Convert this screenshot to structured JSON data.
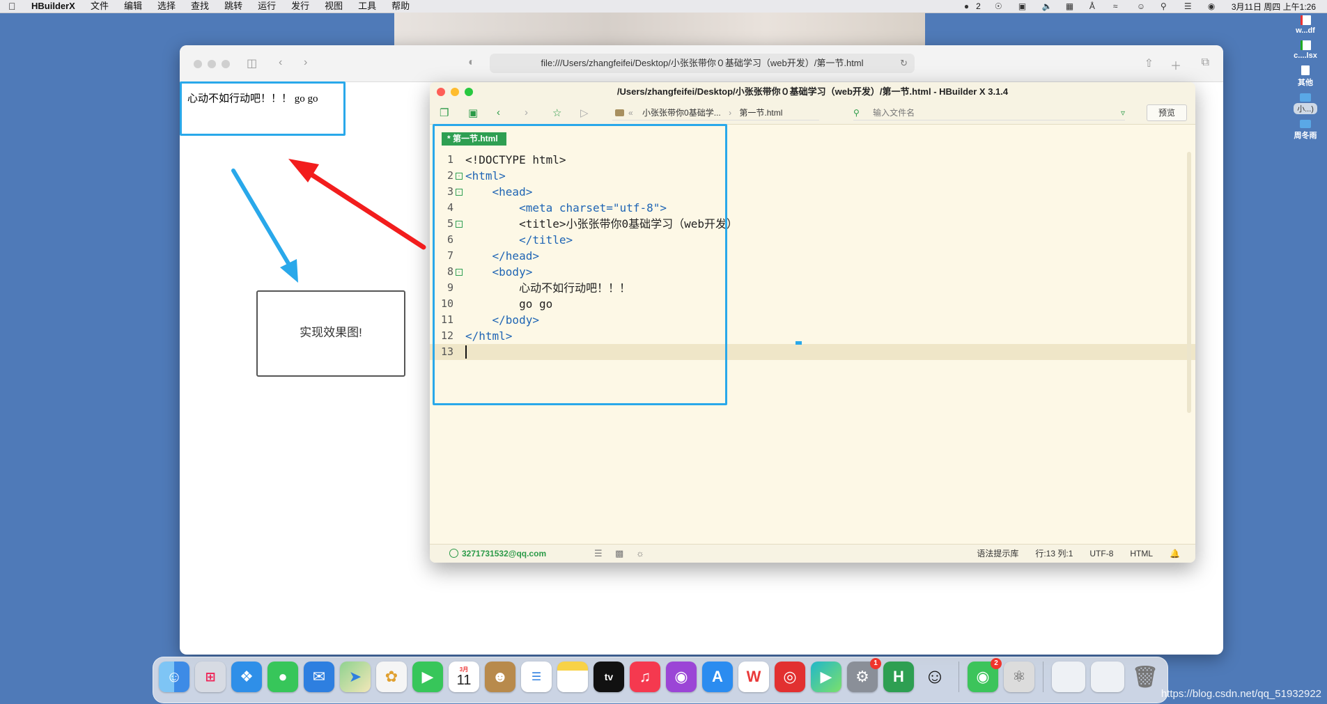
{
  "menubar": {
    "apple": "",
    "app_name": "HBuilderX",
    "menus": [
      "文件",
      "编辑",
      "选择",
      "查找",
      "跳转",
      "运行",
      "发行",
      "视图",
      "工具",
      "帮助"
    ],
    "wechat_count": "2",
    "datetime": "3月11日 周四 上午1:26"
  },
  "desktop_files": [
    {
      "label": "w...df",
      "kind": "pdf"
    },
    {
      "label": "c....lsx",
      "kind": "xlsx"
    },
    {
      "label": "其他",
      "kind": "doc"
    },
    {
      "label": "小...)",
      "kind": "folder"
    },
    {
      "label": "周冬雨",
      "kind": "folder"
    }
  ],
  "browser": {
    "url": "file:///Users/zhangfeifei/Desktop/小张张带你０基础学习（web开发）/第一节.html",
    "page_text": "心动不如行动吧！！！ go go"
  },
  "annotation": {
    "effect_label": "实现效果图!"
  },
  "editor": {
    "title": "/Users/zhangfeifei/Desktop/小张张带你０基础学习（web开发）/第一节.html - HBuilder X 3.1.4",
    "breadcrumb_parent": "小张张带你0基础学...",
    "breadcrumb_file": "第一节.html",
    "search_placeholder": "输入文件名",
    "preview_label": "预览",
    "tab_label": "* 第一节.html",
    "code_lines": [
      "<!DOCTYPE html>",
      "<html>",
      "    <head>",
      "        <meta charset=\"utf-8\">",
      "        <title>小张张带你0基础学习（web开发）",
      "        </title>",
      "    </head>",
      "    <body>",
      "        心动不如行动吧！！！",
      "        go go",
      "    </body>",
      "</html>",
      ""
    ],
    "line_numbers": [
      "1",
      "2",
      "3",
      "4",
      "5",
      "6",
      "7",
      "8",
      "9",
      "10",
      "11",
      "12",
      "13"
    ],
    "status": {
      "user": "3271731532@qq.com",
      "syntax": "语法提示库",
      "position": "行:13   列:1",
      "encoding": "UTF-8",
      "language": "HTML"
    }
  },
  "dock": {
    "calendar_month": "3月",
    "calendar_day": "11",
    "apps": [
      {
        "name": "Finder",
        "icon": "finder-icon",
        "color": "#3d8be6"
      },
      {
        "name": "Launchpad",
        "icon": "launchpad-icon",
        "color": "#d7dbe3"
      },
      {
        "name": "Safari",
        "icon": "safari-icon",
        "color": "#2f8fe8"
      },
      {
        "name": "Messages",
        "icon": "messages-icon",
        "color": "#37c65a"
      },
      {
        "name": "Mail",
        "icon": "mail-icon",
        "color": "#2e7fe0"
      },
      {
        "name": "Maps",
        "icon": "maps-icon",
        "color": "#5cb85c"
      },
      {
        "name": "Photos",
        "icon": "photos-icon",
        "color": "#f5f5f5"
      },
      {
        "name": "FaceTime",
        "icon": "facetime-icon",
        "color": "#37c65a"
      },
      {
        "name": "Calendar",
        "icon": "calendar-icon",
        "color": "#ffffff"
      },
      {
        "name": "Contacts",
        "icon": "contacts-icon",
        "color": "#b88a4c"
      },
      {
        "name": "Reminders",
        "icon": "reminders-icon",
        "color": "#ffffff"
      },
      {
        "name": "Notes",
        "icon": "notes-icon",
        "color": "#f8d247"
      },
      {
        "name": "TV",
        "icon": "tv-icon",
        "color": "#111111"
      },
      {
        "name": "Music",
        "icon": "music-icon",
        "color": "#f5394f"
      },
      {
        "name": "Podcasts",
        "icon": "podcasts-icon",
        "color": "#9b45d6"
      },
      {
        "name": "App Store",
        "icon": "appstore-icon",
        "color": "#2b8cf0"
      },
      {
        "name": "WPS",
        "icon": "wps-icon",
        "color": "#e93a3a"
      },
      {
        "name": "NetEase Music",
        "icon": "netease-music-icon",
        "color": "#e23030"
      },
      {
        "name": "Player",
        "icon": "player-icon",
        "color": "#22b7c9"
      },
      {
        "name": "System Preferences",
        "icon": "settings-icon",
        "color": "#8a8f98",
        "badge": "1"
      },
      {
        "name": "HBuilderX",
        "icon": "hbuilderx-icon",
        "color": "#2e9f52"
      },
      {
        "name": "QQ",
        "icon": "qq-icon",
        "color": "#f0f0f0"
      },
      {
        "name": "WeChat",
        "icon": "wechat-icon",
        "color": "#3cc45b",
        "badge": "2"
      },
      {
        "name": "Automator",
        "icon": "automator-icon",
        "color": "#dcdcdc"
      }
    ]
  },
  "watermark": "https://blog.csdn.net/qq_51932922"
}
